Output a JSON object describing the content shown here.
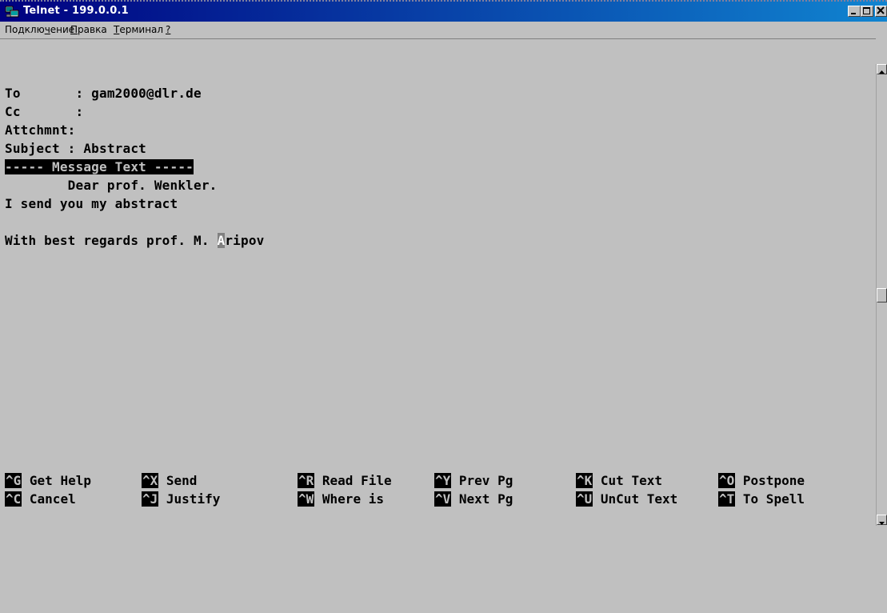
{
  "window": {
    "title": "Telnet - 199.0.0.1",
    "icon": "telnet-computer-icon"
  },
  "menu": {
    "items": [
      {
        "label": "Подключение",
        "underline_index": 8
      },
      {
        "label": "Правка",
        "underline_index": 0
      },
      {
        "label": "Терминал",
        "underline_index": 0
      },
      {
        "label": "?",
        "underline_index": 0
      }
    ]
  },
  "email": {
    "to_label": "To       : ",
    "to_value": "gam2000@dlr.de",
    "cc_label": "Cc       :",
    "attach_label": "Attchmnt:",
    "subject_label": "Subject : ",
    "subject_value": "Abstract",
    "separator": "----- Message Text -----",
    "body_line1": "        Dear prof. Wenkler.",
    "body_line2": "I send you my abstract",
    "body_line3_before": "With best regards prof. M. ",
    "cursor_char": "A",
    "body_line3_after": "ripov"
  },
  "shortcuts": {
    "row1": [
      {
        "key": "^G",
        "label": "Get Help"
      },
      {
        "key": "^X",
        "label": "Send"
      },
      {
        "key": "^R",
        "label": "Read File"
      },
      {
        "key": "^Y",
        "label": "Prev Pg"
      },
      {
        "key": "^K",
        "label": "Cut Text"
      },
      {
        "key": "^O",
        "label": "Postpone"
      }
    ],
    "row2": [
      {
        "key": "^C",
        "label": "Cancel"
      },
      {
        "key": "^J",
        "label": "Justify"
      },
      {
        "key": "^W",
        "label": "Where is"
      },
      {
        "key": "^V",
        "label": "Next Pg"
      },
      {
        "key": "^U",
        "label": "UnCut Text"
      },
      {
        "key": "^T",
        "label": "To Spell"
      }
    ]
  },
  "colors": {
    "titlebar_start": "#000080",
    "titlebar_end": "#1084d0",
    "terminal_bg": "#c0c0c0",
    "text": "#000000"
  }
}
